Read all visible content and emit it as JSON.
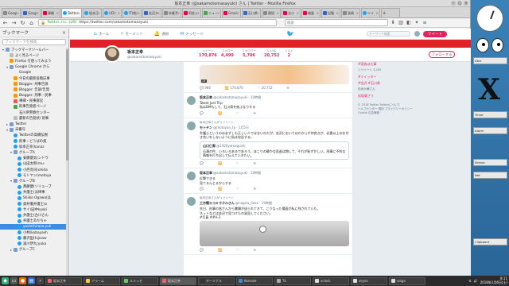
{
  "window": {
    "title": "坂本正幸 (@sakamotomasayuki) さん | Twitter - Mozilla Firefox"
  },
  "tabs": [
    {
      "label": "Google",
      "icon": "gy"
    },
    {
      "label": "Googl",
      "icon": "bl"
    },
    {
      "label": "事細",
      "icon": "rd"
    },
    {
      "label": "Twitter",
      "icon": "tw",
      "active": true
    },
    {
      "label": "坂本正",
      "icon": "tw"
    },
    {
      "label": "(42)",
      "icon": "tw"
    },
    {
      "label": "IT(地)",
      "icon": "tw"
    },
    {
      "label": "金沢大学",
      "icon": "bl"
    },
    {
      "label": "卒業予",
      "icon": "gy"
    },
    {
      "label": "阿佐ヶ",
      "icon": "rd"
    },
    {
      "label": "ニュー",
      "icon": "gr"
    },
    {
      "label": "Gmail",
      "icon": "rd"
    },
    {
      "label": "石川県",
      "icon": "bl"
    },
    {
      "label": "建設",
      "icon": "gy"
    },
    {
      "label": "全小",
      "icon": "or"
    },
    {
      "label": "福島",
      "icon": "rd"
    },
    {
      "label": "記憶",
      "icon": "bl"
    },
    {
      "label": "長崎",
      "icon": "gy"
    },
    {
      "label": "ツイ",
      "icon": "tw"
    }
  ],
  "navbar": {
    "url": "https://twitter.com/sakamotomasayuki",
    "url_badge": "Twitter, Inc. (US)",
    "search_placeholder": "検索"
  },
  "sidebar": {
    "title": "ブックマーク",
    "close": "×",
    "search_placeholder": "ブックマークを検索",
    "items": [
      {
        "label": "ブックマークツールバー",
        "icon": "folder",
        "depth": 0,
        "arrow": "▾"
      },
      {
        "label": "よく見るページ",
        "icon": "pg",
        "depth": 1
      },
      {
        "label": "Firefox を使ってみよう",
        "icon": "or",
        "depth": 1
      },
      {
        "label": "Google Chrome から",
        "icon": "folder",
        "depth": 1,
        "arrow": "▾"
      },
      {
        "label": "Google",
        "icon": "bl",
        "depth": 2
      },
      {
        "label": "今日の最新投稿記事",
        "icon": "or",
        "depth": 2
      },
      {
        "label": "Blogger: 刑事告訴",
        "icon": "or",
        "depth": 2
      },
      {
        "label": "Blogger: 告訴/告発",
        "icon": "or",
        "depth": 2
      },
      {
        "label": "Blogger: 刑事・民事",
        "icon": "or",
        "depth": 2
      },
      {
        "label": "事細・民事訴訟",
        "icon": "rd",
        "depth": 2
      },
      {
        "label": "刑事告発者ページ",
        "icon": "gr",
        "depth": 2
      },
      {
        "label": "石川県警察センター",
        "icon": "bl",
        "depth": 2
      },
      {
        "label": "最新の告発状/ 刑事",
        "icon": "pg",
        "depth": 2
      },
      {
        "label": "Twitter",
        "icon": "folder",
        "depth": 1,
        "arrow": "▸"
      },
      {
        "label": "未番号",
        "icon": "folder",
        "depth": 1,
        "arrow": "▾"
      },
      {
        "label": "Twitterの高橋弘樹",
        "icon": "bm",
        "depth": 2
      },
      {
        "label": "刑事・どうばの奥",
        "icon": "bm",
        "depth": 2
      },
      {
        "label": "坂本正幸(kanaz",
        "icon": "bm",
        "depth": 2
      },
      {
        "label": "グループA",
        "icon": "folder",
        "depth": 2,
        "arrow": "▾"
      },
      {
        "label": "安藤健太(ンドウ",
        "icon": "bm",
        "depth": 3
      },
      {
        "label": "山田太郎(mu-",
        "icon": "bm",
        "depth": 3
      },
      {
        "label": "小西亮司(ohida",
        "icon": "bm",
        "depth": 3
      },
      {
        "label": "モトヤン(motoya",
        "icon": "bm",
        "depth": 3
      },
      {
        "label": "グループB",
        "icon": "folder",
        "depth": 2,
        "arrow": "▾"
      },
      {
        "label": "斎藤健(ソリューブ",
        "icon": "bm",
        "depth": 3
      },
      {
        "label": "弁護士(法律事",
        "icon": "bm",
        "depth": 3
      },
      {
        "label": "Shiiko Ogawa(は",
        "icon": "bm",
        "depth": 3
      },
      {
        "label": "奥村徹弁護士(o",
        "icon": "bm",
        "depth": 3
      },
      {
        "label": "サイ(田中kyoki",
        "icon": "bm",
        "depth": 3
      },
      {
        "label": "弁護士(古川さん",
        "icon": "bm",
        "depth": 3
      },
      {
        "label": "弁護士あだちゃ",
        "icon": "bm",
        "depth": 3
      },
      {
        "label": "yoshi(hirasa.yuli",
        "icon": "bm",
        "depth": 3,
        "selected": true
      },
      {
        "label": "小林(kobayash",
        "icon": "bm",
        "depth": 3
      },
      {
        "label": "藤沢田(fujisaw",
        "icon": "bm",
        "depth": 3
      },
      {
        "label": "湯川伊九(yuka",
        "icon": "bm",
        "depth": 3
      },
      {
        "label": "グループC",
        "icon": "folder",
        "depth": 2,
        "arrow": "▸"
      }
    ]
  },
  "twitter_nav": {
    "home": "ホーム",
    "moments": "モーメント",
    "notifications": "通知",
    "messages": "メッセージ",
    "search_placeholder": "キーワード検索",
    "tweet_button": "ツイート"
  },
  "profile": {
    "name": "坂本正幸",
    "handle": "@sakamotomasayuki",
    "follow_button": "フォローする",
    "stats": [
      {
        "label": "ツイート",
        "value": "170,876"
      },
      {
        "label": "フォロー",
        "value": "4,499"
      },
      {
        "label": "フォロワー",
        "value": "5,706"
      },
      {
        "label": "いいね",
        "value": "20,752"
      },
      {
        "label": "リスト",
        "value": "2"
      }
    ]
  },
  "tweets": [
    {
      "context": "",
      "name": "",
      "handle": "",
      "text": "",
      "image": "gif",
      "gif_label": "GIF",
      "actions": [
        "💬 986",
        "🔁 170,876",
        "♡ 20,752",
        "✉"
      ]
    },
    {
      "context": "",
      "name": "坂本正幸",
      "handle": "@sakamotomasayuki · 10時間",
      "text": "Tweet Just Trip\n私はDMもして、石川県を結ぶなりする",
      "actions": [
        "💬",
        "🔁",
        "♡",
        "✉"
      ]
    },
    {
      "context": "坂本正幸さんがリツイート",
      "name": "モトヤン",
      "handle": "@motoyan_ty · 1月5日",
      "text": "弁護士というのは必ずしも正しい人ではないのだが、金沢においてはわからず仲良きが、必要以上のお付き合いをしないように私は忠告する。",
      "quote": {
        "name": "山口仁郎",
        "handle": "@1920yamaguchi",
        "text": "石澤の件、いろいろあるであろう。ほこりの静かな見逃は期して、それが恥ずかしい。刑事に不利な情報を打ち出して伝えていきたい。"
      },
      "actions": [
        "💬",
        "🔁",
        "♡",
        "✉"
      ]
    },
    {
      "context": "",
      "name": "坂本正幸",
      "handle": "@sakamotomasayuki · 10時間",
      "text": "反撃できる\n見てるんとるからする",
      "actions": [
        "💬",
        "🔁",
        "♡",
        "✉"
      ]
    },
    {
      "context": "坂本正幸さんがリツイート",
      "name": "三方懐エコミラクルさん",
      "handle": "@nagisa_miko · 19時間",
      "text": "先日、刑事の皆さんから書類が送られてきて、こうなった場面が私に残されていた。\nネットなどは金沢で見つけたの発見してください。\n#写真 ##4-3",
      "image": "photo",
      "actions": [
        "💬",
        "🔁",
        "♡",
        "✉"
      ]
    }
  ],
  "right_column": {
    "trends": [
      {
        "tag": "#家族は大事",
        "sub": "リツイート 3,245"
      },
      {
        "tag": "#ツイッター",
        "sub": ""
      },
      {
        "tag": "#金沢 #石川県",
        "sub": "松坂大輔さん"
      },
      {
        "tag": "松坂健さう",
        "sub": ""
      }
    ],
    "footer": "© 2018 Twitter  Twitterについて\nヘルプセンター  規約  プライバシーポリシー\nCookie  広告情報"
  },
  "widgets": {
    "box1": "Xfce",
    "box2": "Timer",
    "box3": "Alarm",
    "box4": "Sensor",
    "box5": "Net",
    "box6": "Clipboard",
    "bigx": "X"
  },
  "taskbar": {
    "tasks": [
      {
        "label": "坂本正幸",
        "color": "#e66"
      },
      {
        "label": "アラーム",
        "color": "#fc3"
      },
      {
        "label": "ルメッセ",
        "color": "#6c6"
      },
      {
        "label": "坂本正幸",
        "color": "#e66",
        "active": true
      },
      {
        "label": "ターミナル",
        "color": "#333"
      },
      {
        "label": "Konsole",
        "color": "#48c"
      },
      {
        "label": "Tk",
        "color": "#aaa"
      },
      {
        "label": "xclock",
        "color": "#ddd"
      },
      {
        "label": "xeyes",
        "color": "#ddd"
      },
      {
        "label": "xlogo",
        "color": "#ddd"
      }
    ],
    "time": "8:11",
    "date": "2018年1月6日(土)"
  },
  "colors": {
    "twitter_blue": "#1da1f2",
    "profile_accent": "#e0245e",
    "banner": "#e0202a",
    "selection": "#3d8ee0"
  }
}
